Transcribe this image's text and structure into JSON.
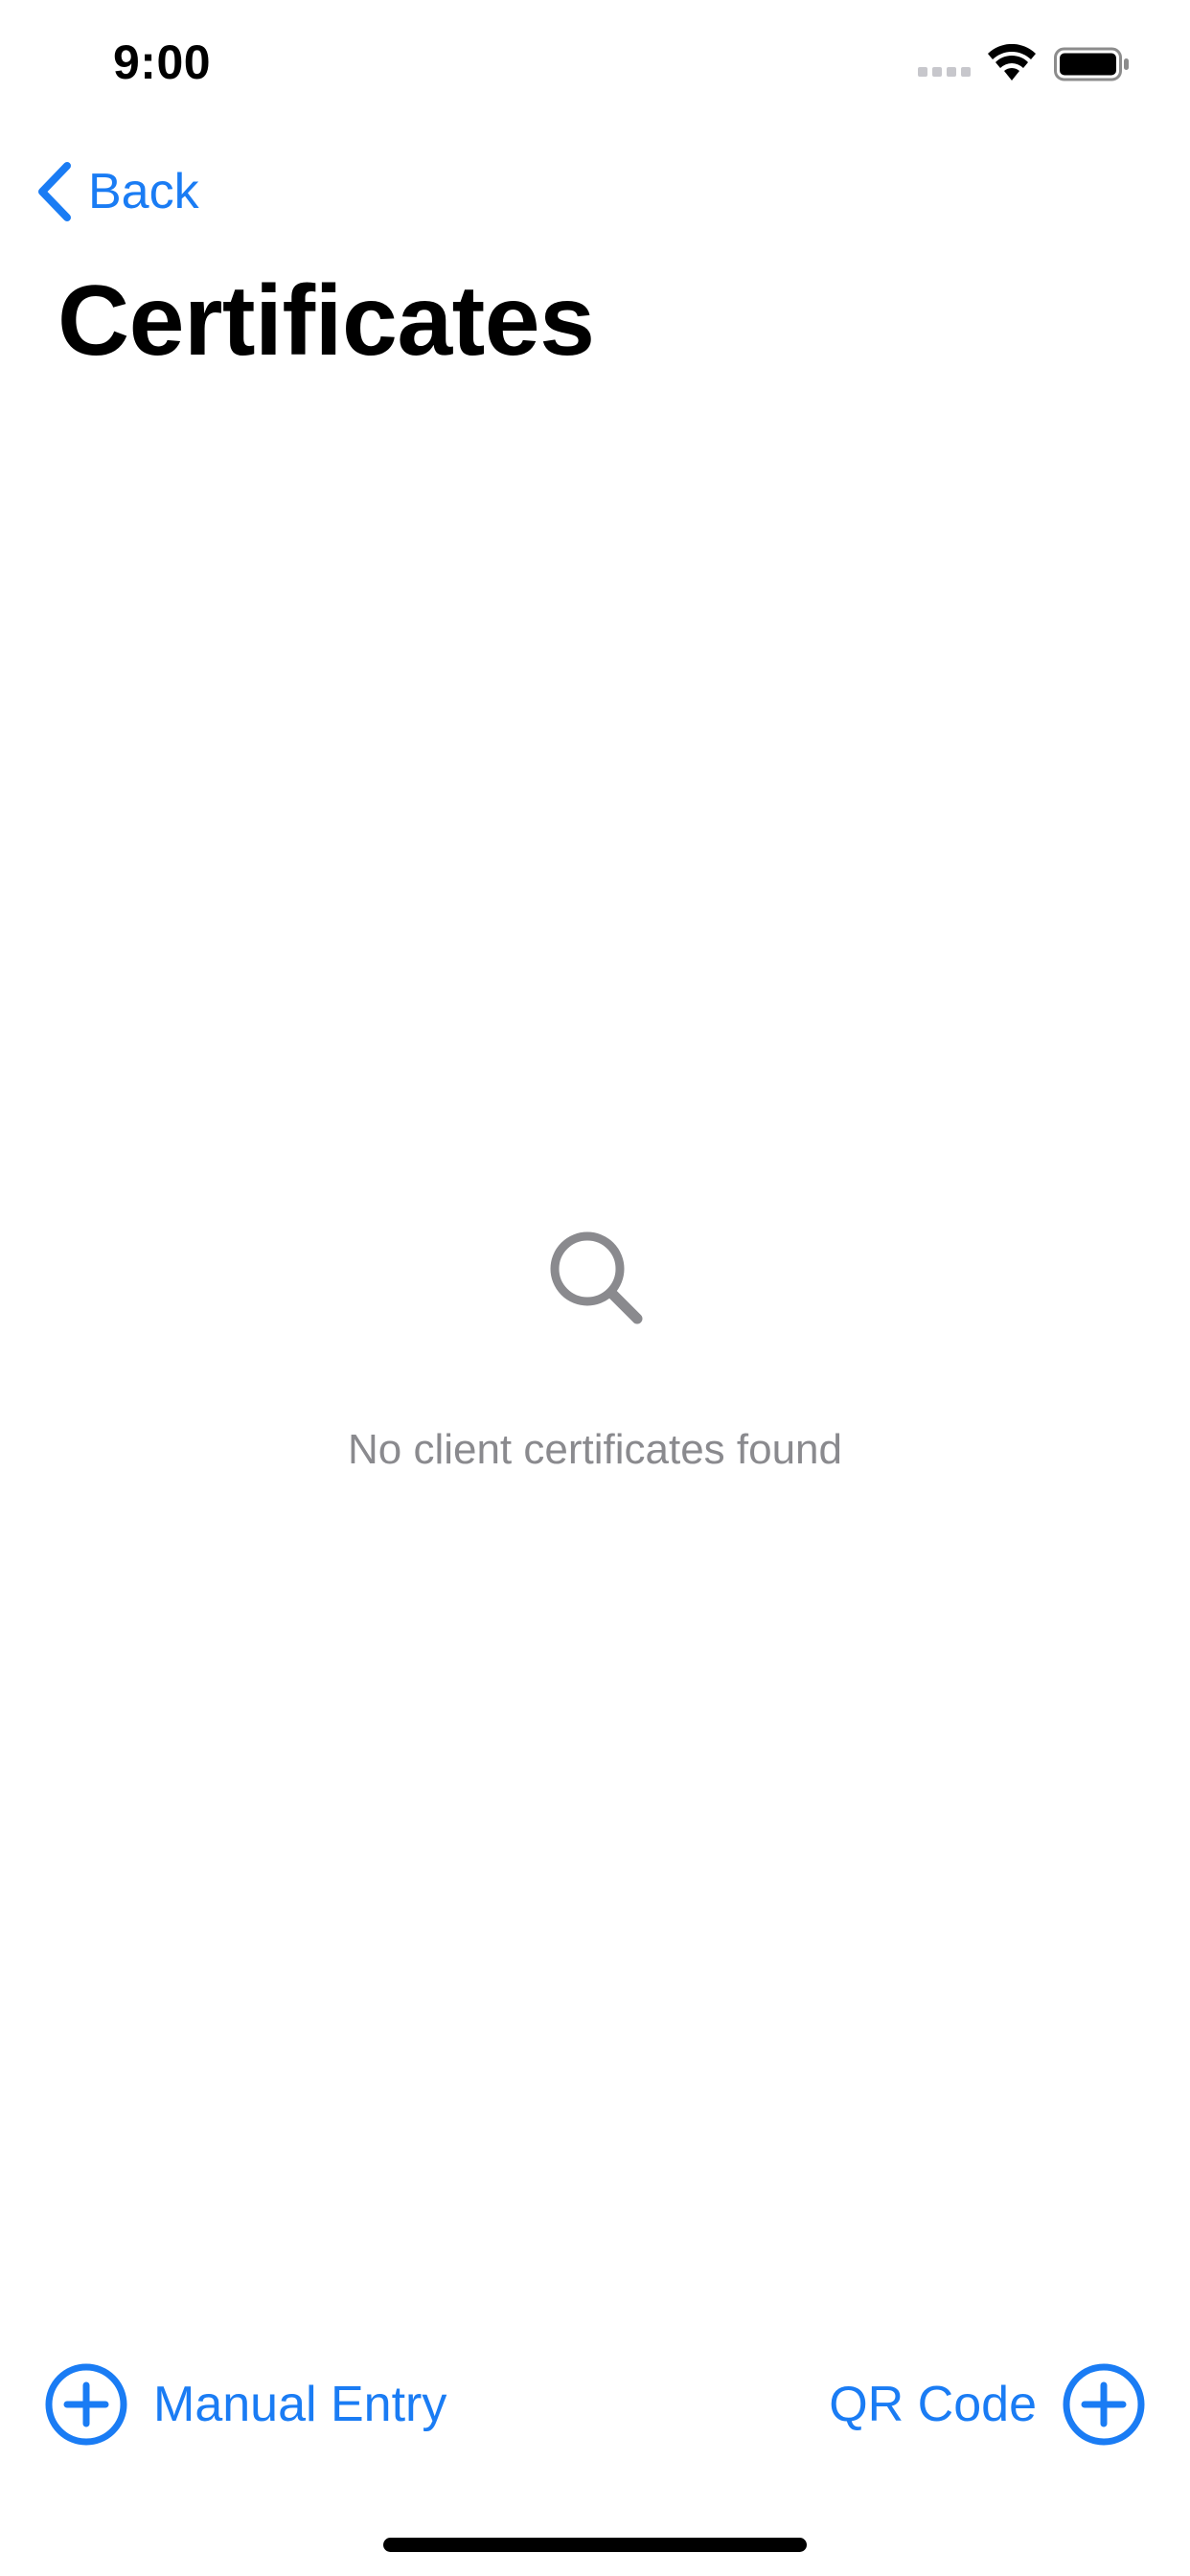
{
  "status_bar": {
    "time": "9:00",
    "signal_icon": "cellular-signal-icon",
    "wifi_icon": "wifi-icon",
    "battery_icon": "battery-icon"
  },
  "nav": {
    "back_label": "Back",
    "back_icon": "chevron-left-icon",
    "title": "Certificates"
  },
  "empty_state": {
    "icon": "magnifying-glass-icon",
    "message": "No client certificates found"
  },
  "toolbar": {
    "manual_entry_label": "Manual Entry",
    "qr_code_label": "QR Code",
    "add_icon": "plus-circle-icon"
  },
  "colors": {
    "accent": "#1A7CF4",
    "secondary_text": "#8A8A8E",
    "background": "#FFFFFF",
    "primary_text": "#000000"
  }
}
